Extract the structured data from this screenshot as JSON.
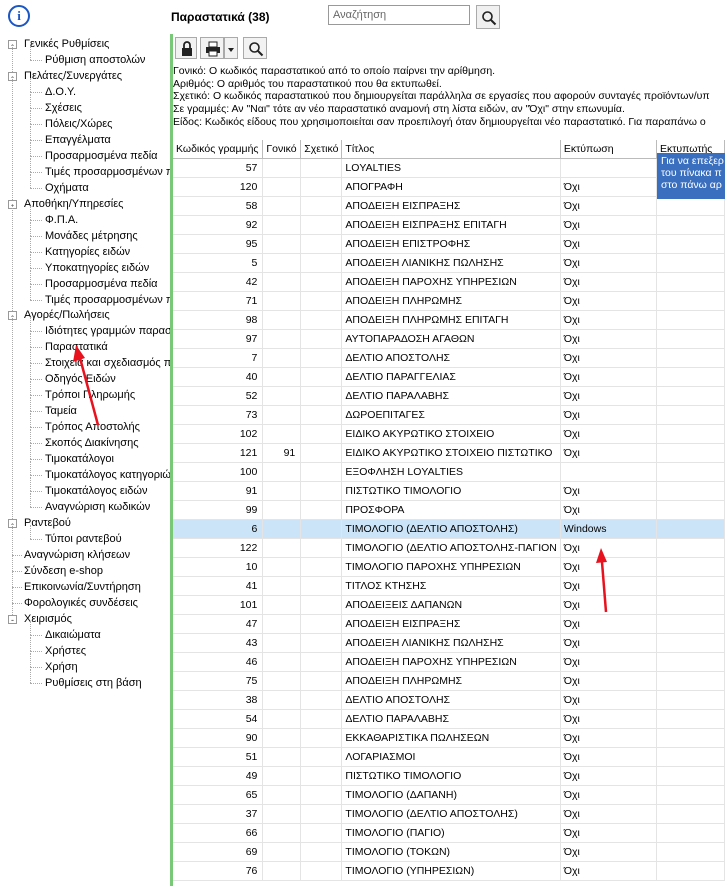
{
  "header": {
    "info_icon": "info-icon",
    "title": "Παραστατικά (38)",
    "search_placeholder": "Αναζήτηση",
    "search_icon": "search-icon"
  },
  "toolbar": {
    "lock_icon": "lock-icon",
    "print_icon": "printer-icon",
    "dropdown_icon": "chevron-down-icon",
    "search_icon": "search-icon"
  },
  "sidebar": {
    "items": [
      {
        "label": "Γενικές Ρυθμίσεις",
        "level": 0,
        "toggle": "-"
      },
      {
        "label": "Ρύθμιση αποστολών",
        "level": 1
      },
      {
        "label": "Πελάτες/Συνεργάτες",
        "level": 0,
        "toggle": "-"
      },
      {
        "label": "Δ.Ο.Υ.",
        "level": 1
      },
      {
        "label": "Σχέσεις",
        "level": 1
      },
      {
        "label": "Πόλεις/Χώρες",
        "level": 1
      },
      {
        "label": "Επαγγέλματα",
        "level": 1
      },
      {
        "label": "Προσαρμοσμένα πεδία",
        "level": 1
      },
      {
        "label": "Τιμές προσαρμοσμένων π",
        "level": 1
      },
      {
        "label": "Οχήματα",
        "level": 1
      },
      {
        "label": "Αποθήκη/Υπηρεσίες",
        "level": 0,
        "toggle": "-"
      },
      {
        "label": "Φ.Π.Α.",
        "level": 1
      },
      {
        "label": "Μονάδες μέτρησης",
        "level": 1
      },
      {
        "label": "Κατηγορίες ειδών",
        "level": 1
      },
      {
        "label": "Υποκατηγορίες ειδών",
        "level": 1
      },
      {
        "label": "Προσαρμοσμένα πεδία",
        "level": 1
      },
      {
        "label": "Τιμές προσαρμοσμένων π",
        "level": 1
      },
      {
        "label": "Αγορές/Πωλήσεις",
        "level": 0,
        "toggle": "-"
      },
      {
        "label": "Ιδιότητες γραμμών παρασ",
        "level": 1
      },
      {
        "label": "Παραστατικά",
        "level": 1
      },
      {
        "label": "Στοιχεία και σχεδιασμός π",
        "level": 1
      },
      {
        "label": "Οδηγός Ειδών",
        "level": 1
      },
      {
        "label": "Τρόποι Πληρωμής",
        "level": 1
      },
      {
        "label": "Ταμεία",
        "level": 1
      },
      {
        "label": "Τρόπος Αποστολής",
        "level": 1
      },
      {
        "label": "Σκοπός Διακίνησης",
        "level": 1
      },
      {
        "label": "Τιμοκατάλογοι",
        "level": 1
      },
      {
        "label": "Τιμοκατάλογος κατηγοριώ",
        "level": 1
      },
      {
        "label": "Τιμοκατάλογος ειδών",
        "level": 1
      },
      {
        "label": "Αναγνώριση κωδικών",
        "level": 1
      },
      {
        "label": "Ραντεβού",
        "level": 0,
        "toggle": "-"
      },
      {
        "label": "Τύποι ραντεβού",
        "level": 1
      },
      {
        "label": "Αναγνώριση κλήσεων",
        "level": 0
      },
      {
        "label": "Σύνδεση e-shop",
        "level": 0
      },
      {
        "label": "Επικοινωνία/Συντήρηση",
        "level": 0
      },
      {
        "label": "Φορολογικές συνδέσεις",
        "level": 0
      },
      {
        "label": "Χειρισμός",
        "level": 0,
        "toggle": "-"
      },
      {
        "label": "Δικαιώματα",
        "level": 1
      },
      {
        "label": "Χρήστες",
        "level": 1
      },
      {
        "label": "Χρήση",
        "level": 1
      },
      {
        "label": "Ρυθμίσεις στη βάση",
        "level": 1
      }
    ]
  },
  "description": [
    "Γονικό: Ο κωδικός παραστατικού από το οποίο παίρνει την αρίθμηση.",
    "Αριθμός: Ο αριθμός του παραστατικού που θα εκτυπωθεί.",
    "Σχετικό: Ο κωδικός παραστατικού που δημιουργείται παράλληλα σε εργασίες που αφορούν συνταγές προϊόντων/υπ",
    "Σε γραμμές: Αν \"Ναι\" τότε αν νέο παραστατικό αναμονή στη λίστα ειδών, αν \"Όχι\" στην επωνυμία.",
    "Είδος: Κωδικός είδους που χρησιμοποιείται σαν προεπιλογή όταν δημιουργείται νέο παραστατικό. Για παραπάνω ο"
  ],
  "table": {
    "columns": [
      "Κωδικός γραμμής",
      "Γονικό",
      "Σχετικό",
      "Τίτλος",
      "Εκτύπωση",
      "Εκτυπωτής"
    ],
    "rows": [
      [
        "57",
        "",
        "",
        "LOYALTIES",
        "",
        ""
      ],
      [
        "120",
        "",
        "",
        "ΑΠΟΓΡΑΦΗ",
        "Όχι",
        ""
      ],
      [
        "58",
        "",
        "",
        "ΑΠΟΔΕΙΞΗ ΕΙΣΠΡΑΞΗΣ",
        "Όχι",
        ""
      ],
      [
        "92",
        "",
        "",
        "ΑΠΟΔΕΙΞΗ ΕΙΣΠΡΑΞΗΣ ΕΠΙΤΑΓΗ",
        "Όχι",
        ""
      ],
      [
        "95",
        "",
        "",
        "ΑΠΟΔΕΙΞΗ ΕΠΙΣΤΡΟΦΗΣ",
        "Όχι",
        ""
      ],
      [
        "5",
        "",
        "",
        "ΑΠΟΔΕΙΞΗ ΛΙΑΝΙΚΗΣ ΠΩΛΗΣΗΣ",
        "Όχι",
        ""
      ],
      [
        "42",
        "",
        "",
        "ΑΠΟΔΕΙΞΗ ΠΑΡΟΧΗΣ ΥΠΗΡΕΣΙΩΝ",
        "Όχι",
        ""
      ],
      [
        "71",
        "",
        "",
        "ΑΠΟΔΕΙΞΗ ΠΛΗΡΩΜΗΣ",
        "Όχι",
        ""
      ],
      [
        "98",
        "",
        "",
        "ΑΠΟΔΕΙΞΗ ΠΛΗΡΩΜΗΣ ΕΠΙΤΑΓΗ",
        "Όχι",
        ""
      ],
      [
        "97",
        "",
        "",
        "ΑΥΤΟΠΑΡΑΔΟΣΗ ΑΓΑΘΩΝ",
        "Όχι",
        ""
      ],
      [
        "7",
        "",
        "",
        "ΔΕΛΤΙΟ ΑΠΟΣΤΟΛΗΣ",
        "Όχι",
        ""
      ],
      [
        "40",
        "",
        "",
        "ΔΕΛΤΙΟ ΠΑΡΑΓΓΕΛΙΑΣ",
        "Όχι",
        ""
      ],
      [
        "52",
        "",
        "",
        "ΔΕΛΤΙΟ ΠΑΡΑΛΑΒΗΣ",
        "Όχι",
        ""
      ],
      [
        "73",
        "",
        "",
        "ΔΩΡΟΕΠΙΤΑΓΕΣ",
        "Όχι",
        ""
      ],
      [
        "102",
        "",
        "",
        "ΕΙΔΙΚΟ ΑΚΥΡΩΤΙΚΟ ΣΤΟΙΧΕΙΟ",
        "Όχι",
        ""
      ],
      [
        "121",
        "91",
        "",
        "ΕΙΔΙΚΟ ΑΚΥΡΩΤΙΚΟ ΣΤΟΙΧΕΙΟ ΠΙΣΤΩΤΙΚΟ",
        "Όχι",
        ""
      ],
      [
        "100",
        "",
        "",
        "ΕΞΟΦΛΗΣΗ LOYALTIES",
        "",
        ""
      ],
      [
        "91",
        "",
        "",
        "ΠΙΣΤΩΤΙΚΟ ΤΙΜΟΛΟΓΙΟ",
        "Όχι",
        ""
      ],
      [
        "99",
        "",
        "",
        "ΠΡΟΣΦΟΡΑ",
        "Όχι",
        ""
      ],
      [
        "6",
        "",
        "",
        "ΤΙΜΟΛΟΓΙΟ (ΔΕΛΤΙΟ ΑΠΟΣΤΟΛΗΣ)",
        "Windows",
        ""
      ],
      [
        "122",
        "",
        "",
        "ΤΙΜΟΛΟΓΙΟ (ΔΕΛΤΙΟ ΑΠΟΣΤΟΛΗΣ-ΠΑΓΙΟΝ",
        "Όχι",
        ""
      ],
      [
        "10",
        "",
        "",
        "ΤΙΜΟΛΟΓΙΟ ΠΑΡΟΧΗΣ ΥΠΗΡΕΣΙΩΝ",
        "Όχι",
        ""
      ],
      [
        "41",
        "",
        "",
        "ΤΙΤΛΟΣ ΚΤΗΣΗΣ",
        "Όχι",
        ""
      ],
      [
        "101",
        "",
        "",
        "ΑΠΟΔΕΙΞΕΙΣ ΔΑΠΑΝΩΝ",
        "Όχι",
        ""
      ],
      [
        "47",
        "",
        "",
        "ΑΠΟΔΕΙΞΗ ΕΙΣΠΡΑΞΗΣ",
        "Όχι",
        ""
      ],
      [
        "43",
        "",
        "",
        "ΑΠΟΔΕΙΞΗ ΛΙΑΝΙΚΗΣ ΠΩΛΗΣΗΣ",
        "Όχι",
        ""
      ],
      [
        "46",
        "",
        "",
        "ΑΠΟΔΕΙΞΗ ΠΑΡΟΧΗΣ ΥΠΗΡΕΣΙΩΝ",
        "Όχι",
        ""
      ],
      [
        "75",
        "",
        "",
        "ΑΠΟΔΕΙΞΗ ΠΛΗΡΩΜΗΣ",
        "Όχι",
        ""
      ],
      [
        "38",
        "",
        "",
        "ΔΕΛΤΙΟ ΑΠΟΣΤΟΛΗΣ",
        "Όχι",
        ""
      ],
      [
        "54",
        "",
        "",
        "ΔΕΛΤΙΟ ΠΑΡΑΛΑΒΗΣ",
        "Όχι",
        ""
      ],
      [
        "90",
        "",
        "",
        "ΕΚΚΑΘΑΡΙΣΤΙΚΑ ΠΩΛΗΣΕΩΝ",
        "Όχι",
        ""
      ],
      [
        "51",
        "",
        "",
        "ΛΟΓΑΡΙΑΣΜΟΙ",
        "Όχι",
        ""
      ],
      [
        "49",
        "",
        "",
        "ΠΙΣΤΩΤΙΚΟ ΤΙΜΟΛΟΓΙΟ",
        "Όχι",
        ""
      ],
      [
        "65",
        "",
        "",
        "ΤΙΜΟΛΟΓΙΟ (ΔΑΠΑΝΗ)",
        "Όχι",
        ""
      ],
      [
        "37",
        "",
        "",
        "ΤΙΜΟΛΟΓΙΟ (ΔΕΛΤΙΟ ΑΠΟΣΤΟΛΗΣ)",
        "Όχι",
        ""
      ],
      [
        "66",
        "",
        "",
        "ΤΙΜΟΛΟΓΙΟ (ΠΑΓΙΟ)",
        "Όχι",
        ""
      ],
      [
        "69",
        "",
        "",
        "ΤΙΜΟΛΟΓΙΟ (ΤΟΚΩΝ)",
        "Όχι",
        ""
      ],
      [
        "76",
        "",
        "",
        "ΤΙΜΟΛΟΓΙΟ (ΥΠΗΡΕΣΙΩΝ)",
        "Όχι",
        ""
      ]
    ],
    "selected_row": 19
  },
  "tooltip": {
    "lines": [
      "Για να επεξερ",
      "του πίνακα π",
      "στο πάνω αρ"
    ]
  },
  "colors": {
    "accent_green": "#78c878",
    "selection": "#cce4f7",
    "tooltip_bg": "#3a6fbf",
    "annotation_arrow": "#e8121e"
  }
}
